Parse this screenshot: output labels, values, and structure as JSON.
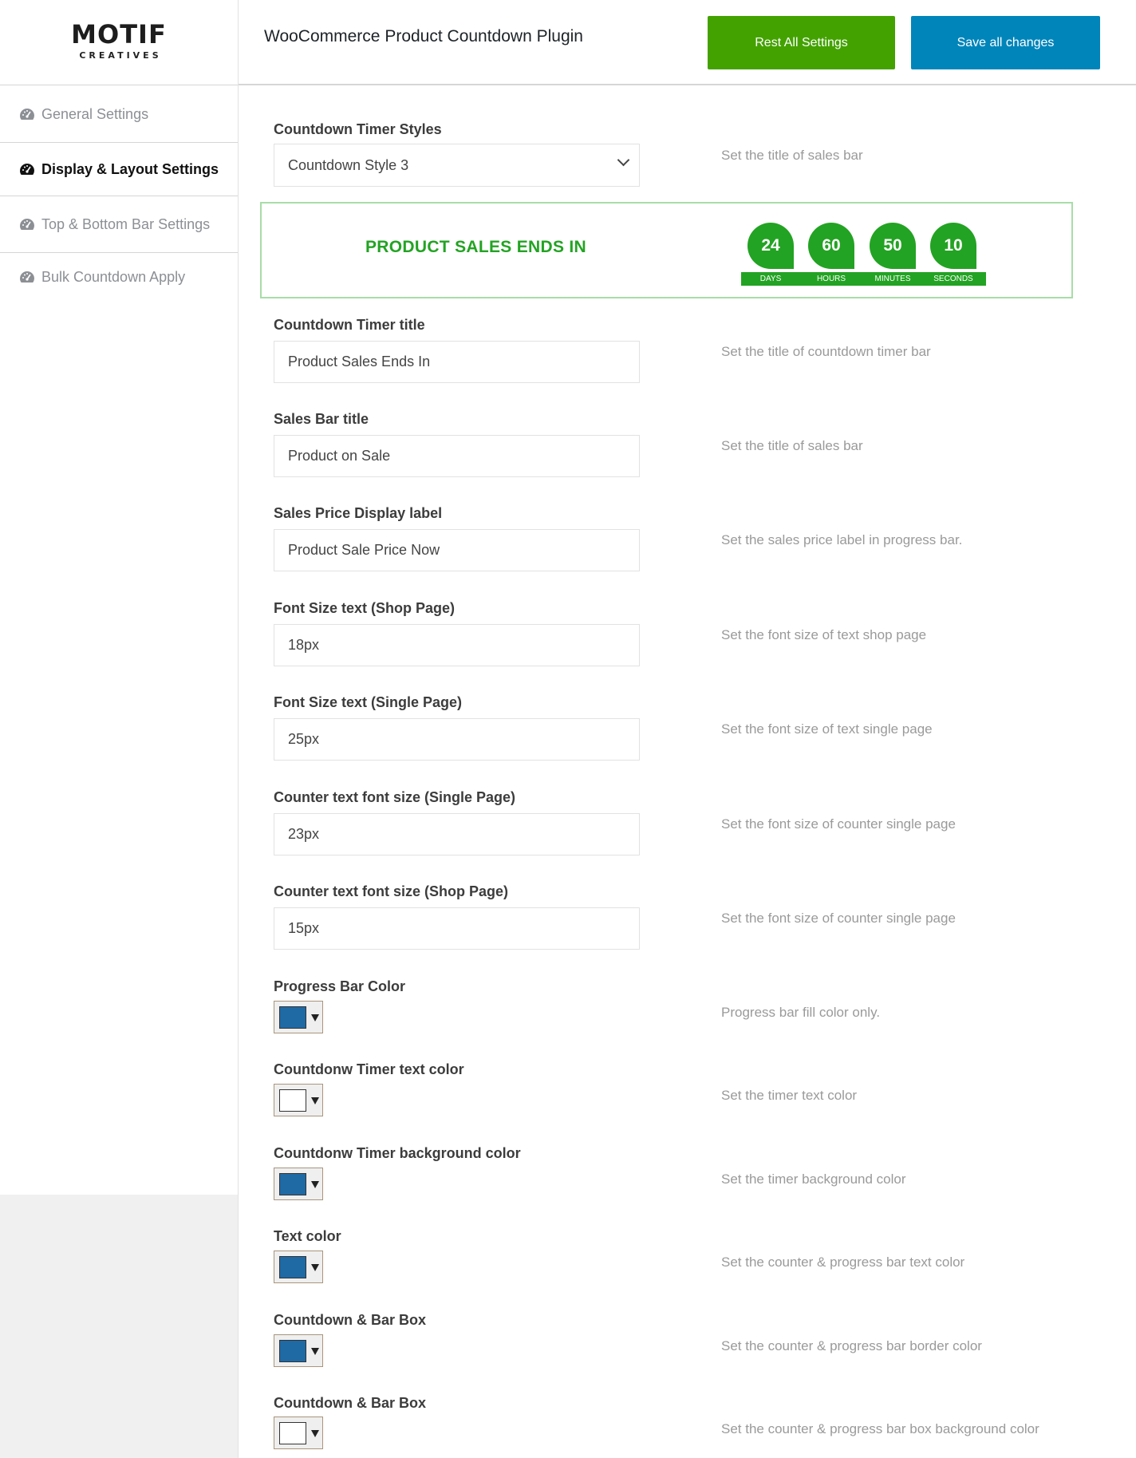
{
  "brand": {
    "logo_main": "MOTIF",
    "logo_sub": "CREATIVES"
  },
  "sidebar": {
    "items": [
      {
        "label": "General Settings",
        "icon": "dashboard-icon",
        "active": false
      },
      {
        "label": "Display & Layout Settings",
        "icon": "dashboard-icon",
        "active": true
      },
      {
        "label": "Top & Bottom Bar Settings",
        "icon": "dashboard-icon",
        "active": false
      },
      {
        "label": "Bulk Countdown Apply",
        "icon": "dashboard-icon",
        "active": false
      }
    ]
  },
  "header": {
    "title": "WooCommerce Product Countdown Plugin",
    "reset_label": "Rest All Settings",
    "save_label": "Save all changes"
  },
  "colors": {
    "reset_button": "#43a200",
    "save_button": "#0085ba",
    "preview_green": "#23a323",
    "picker_blue": "#1f6aa5",
    "picker_white": "#ffffff"
  },
  "style_select": {
    "label": "Countdown Timer Styles",
    "value": "Countdown Style 3",
    "hint": "Set the title of sales bar"
  },
  "preview": {
    "title": "PRODUCT SALES ENDS IN",
    "units": [
      {
        "value": "24",
        "label": "DAYS"
      },
      {
        "value": "60",
        "label": "HOURS"
      },
      {
        "value": "50",
        "label": "MINUTES"
      },
      {
        "value": "10",
        "label": "SECONDS"
      }
    ]
  },
  "text_fields": [
    {
      "label": "Countdown Timer title",
      "value": "Product Sales Ends In",
      "hint": "Set the title of countdown timer bar"
    },
    {
      "label": "Sales Bar title",
      "value": "Product on Sale",
      "hint": "Set the title of sales bar"
    },
    {
      "label": "Sales Price Display label",
      "value": "Product Sale Price Now",
      "hint": "Set the sales price label in progress bar."
    },
    {
      "label": "Font Size text (Shop Page)",
      "value": "18px",
      "hint": "Set the font size of text shop page"
    },
    {
      "label": "Font Size text (Single Page)",
      "value": "25px",
      "hint": "Set the font size of text single page"
    },
    {
      "label": "Counter text font size (Single Page)",
      "value": "23px",
      "hint": "Set the font size of counter single page"
    },
    {
      "label": "Counter text font size (Shop Page)",
      "value": "15px",
      "hint": "Set the font size of counter single page"
    }
  ],
  "color_fields": [
    {
      "label": "Progress Bar Color",
      "color": "#1f6aa5",
      "hint": "Progress bar fill color only."
    },
    {
      "label": "Countdonw Timer text color",
      "color": "#ffffff",
      "hint": "Set the timer text color"
    },
    {
      "label": "Countdonw Timer background color",
      "color": "#1f6aa5",
      "hint": "Set the timer background color"
    },
    {
      "label": "Text color",
      "color": "#1f6aa5",
      "hint": "Set the counter & progress bar text color"
    },
    {
      "label": "Countdown & Bar Box",
      "color": "#1f6aa5",
      "hint": "Set the counter & progress bar border color"
    },
    {
      "label": "Countdown & Bar Box",
      "color": "#ffffff",
      "hint": "Set the counter & progress bar box background color"
    }
  ]
}
